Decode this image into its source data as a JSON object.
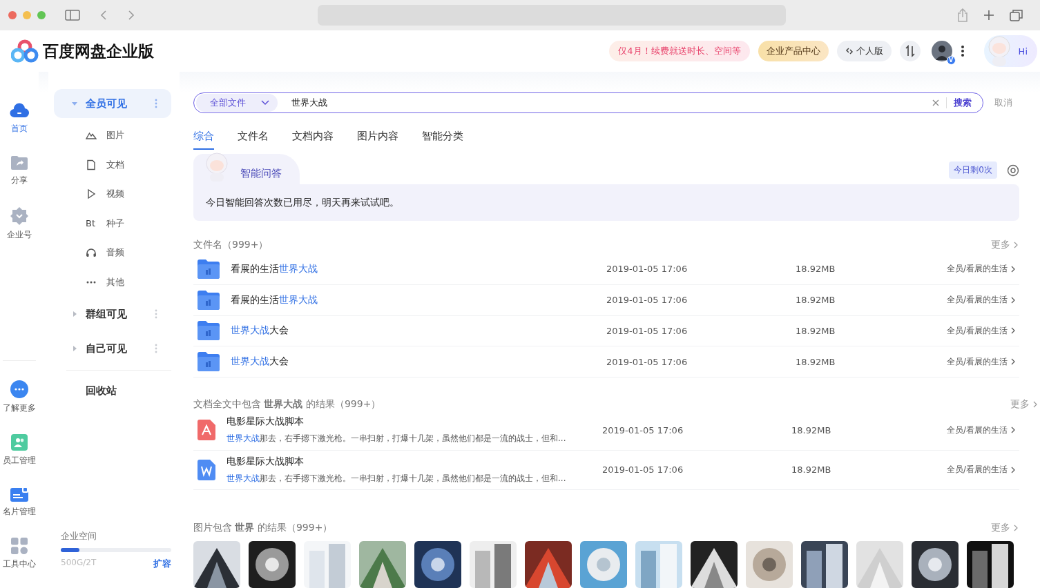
{
  "brand": {
    "name": "百度网盘企业版"
  },
  "header": {
    "promo": "仅4月！续费就送时长、空间等",
    "product_center": "企业产品中心",
    "personal": "个人版",
    "avatar_badge": "V",
    "assistant": "Hi"
  },
  "rail": {
    "items": [
      {
        "label": "首页",
        "selected": true
      },
      {
        "label": "分享",
        "selected": false
      },
      {
        "label": "企业号",
        "selected": false
      }
    ],
    "tools": [
      {
        "label": "了解更多"
      },
      {
        "label": "员工管理"
      },
      {
        "label": "名片管理"
      },
      {
        "label": "工具中心"
      }
    ]
  },
  "tree": [
    {
      "label": "全员可见",
      "expanded": true,
      "selected": true,
      "children": [
        {
          "label": "图片"
        },
        {
          "label": "文档"
        },
        {
          "label": "视频"
        },
        {
          "label": "种子",
          "glyph": "Bt"
        },
        {
          "label": "音频"
        },
        {
          "label": "其他"
        }
      ]
    },
    {
      "label": "群组可见",
      "expanded": false,
      "selected": false
    },
    {
      "label": "自己可见",
      "expanded": false,
      "selected": false
    }
  ],
  "recycle": "回收站",
  "storage": {
    "label": "企业空间",
    "level": 0.17,
    "usage": "500G/2T",
    "expand": "扩容"
  },
  "search": {
    "scope": "全部文件",
    "value": "世界大战",
    "submit": "搜索",
    "cancel": "取消"
  },
  "tabs": [
    {
      "label": "综合",
      "selected": true
    },
    {
      "label": "文件名",
      "selected": false
    },
    {
      "label": "文档内容",
      "selected": false
    },
    {
      "label": "图片内容",
      "selected": false
    },
    {
      "label": "智能分类",
      "selected": false
    }
  ],
  "ai": {
    "title": "智能问答",
    "quota": "今日剩0次",
    "message": "今日智能回答次数已用尽，明天再来试试吧。"
  },
  "file_section": {
    "heading": "文件名（999+）",
    "more": "更多",
    "rows": [
      {
        "kind": "folder",
        "name_parts": [
          {
            "text": "看展的生活",
            "match": false
          },
          {
            "text": "世界大战",
            "match": true
          }
        ],
        "date": "2019-01-05 17:06",
        "size": "18.92MB",
        "path": "全员/看展的生活"
      },
      {
        "kind": "folder",
        "name_parts": [
          {
            "text": "看展的生活",
            "match": false
          },
          {
            "text": "世界大战",
            "match": true
          }
        ],
        "date": "2019-01-05 17:06",
        "size": "18.92MB",
        "path": "全员/看展的生活"
      },
      {
        "kind": "folder",
        "name_parts": [
          {
            "text": "世界大战",
            "match": true
          },
          {
            "text": "大会",
            "match": false
          }
        ],
        "date": "2019-01-05 17:06",
        "size": "18.92MB",
        "path": "全员/看展的生活"
      },
      {
        "kind": "folder",
        "name_parts": [
          {
            "text": "世界大战",
            "match": true
          },
          {
            "text": "大会",
            "match": false
          }
        ],
        "date": "2019-01-05 17:06",
        "size": "18.92MB",
        "path": "全员/看展的生活"
      }
    ]
  },
  "doc_section": {
    "heading": "文档全文中包含 **世界大战** 的结果（999+）",
    "more": "更多",
    "rows": [
      {
        "kind": "pdf",
        "name": "电影星际大战脚本",
        "snippet_parts": [
          {
            "text": "世界大战",
            "match": true
          },
          {
            "text": "那去，右手摁下激光枪。一串扫射，打爆十几架，虽然他们都是一流的战士，但和...",
            "match": false
          }
        ],
        "date": "2019-01-05 17:06",
        "size": "18.92MB",
        "path": "全员/看展的生活"
      },
      {
        "kind": "word",
        "name": "电影星际大战脚本",
        "snippet_parts": [
          {
            "text": "世界大战",
            "match": true
          },
          {
            "text": "那去，右手摁下激光枪。一串扫射，打爆十几架，虽然他们都是一流的战士，但和...",
            "match": false
          }
        ],
        "date": "2019-01-05 17:06",
        "size": "18.92MB",
        "path": "全员/看展的生活"
      }
    ]
  },
  "image_section": {
    "heading": "图片包含 **世界** 的结果（999+）",
    "more": "更多"
  }
}
